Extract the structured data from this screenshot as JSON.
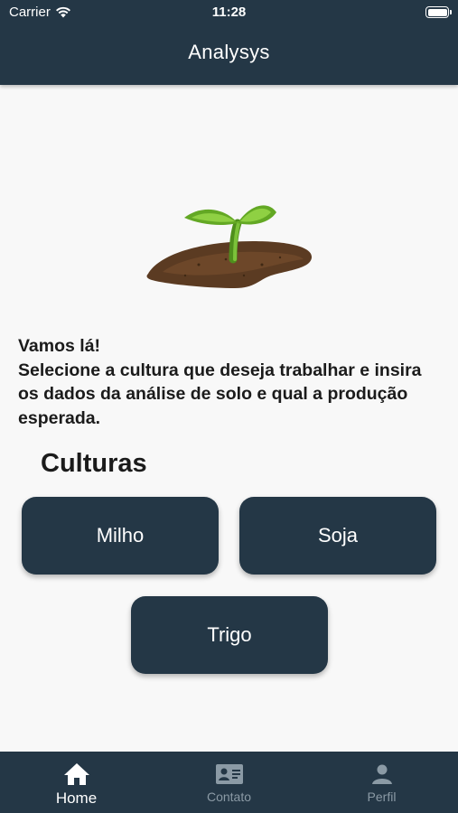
{
  "status_bar": {
    "carrier": "Carrier",
    "time": "11:28"
  },
  "header": {
    "title": "Analysys"
  },
  "intro": {
    "line1": "Vamos lá!",
    "line2": "Selecione a cultura que deseja trabalhar e insira os dados da análise de solo e qual a produção esperada."
  },
  "cultures": {
    "title": "Culturas",
    "items": [
      {
        "label": "Milho"
      },
      {
        "label": "Soja"
      },
      {
        "label": "Trigo"
      }
    ]
  },
  "tabbar": {
    "items": [
      {
        "label": "Home",
        "icon": "home-icon",
        "active": true
      },
      {
        "label": "Contato",
        "icon": "contact-card-icon",
        "active": false
      },
      {
        "label": "Perfil",
        "icon": "person-icon",
        "active": false
      }
    ]
  },
  "colors": {
    "primary": "#243746",
    "background": "#f8f8f8",
    "inactive_tab": "#8b9aa5"
  }
}
